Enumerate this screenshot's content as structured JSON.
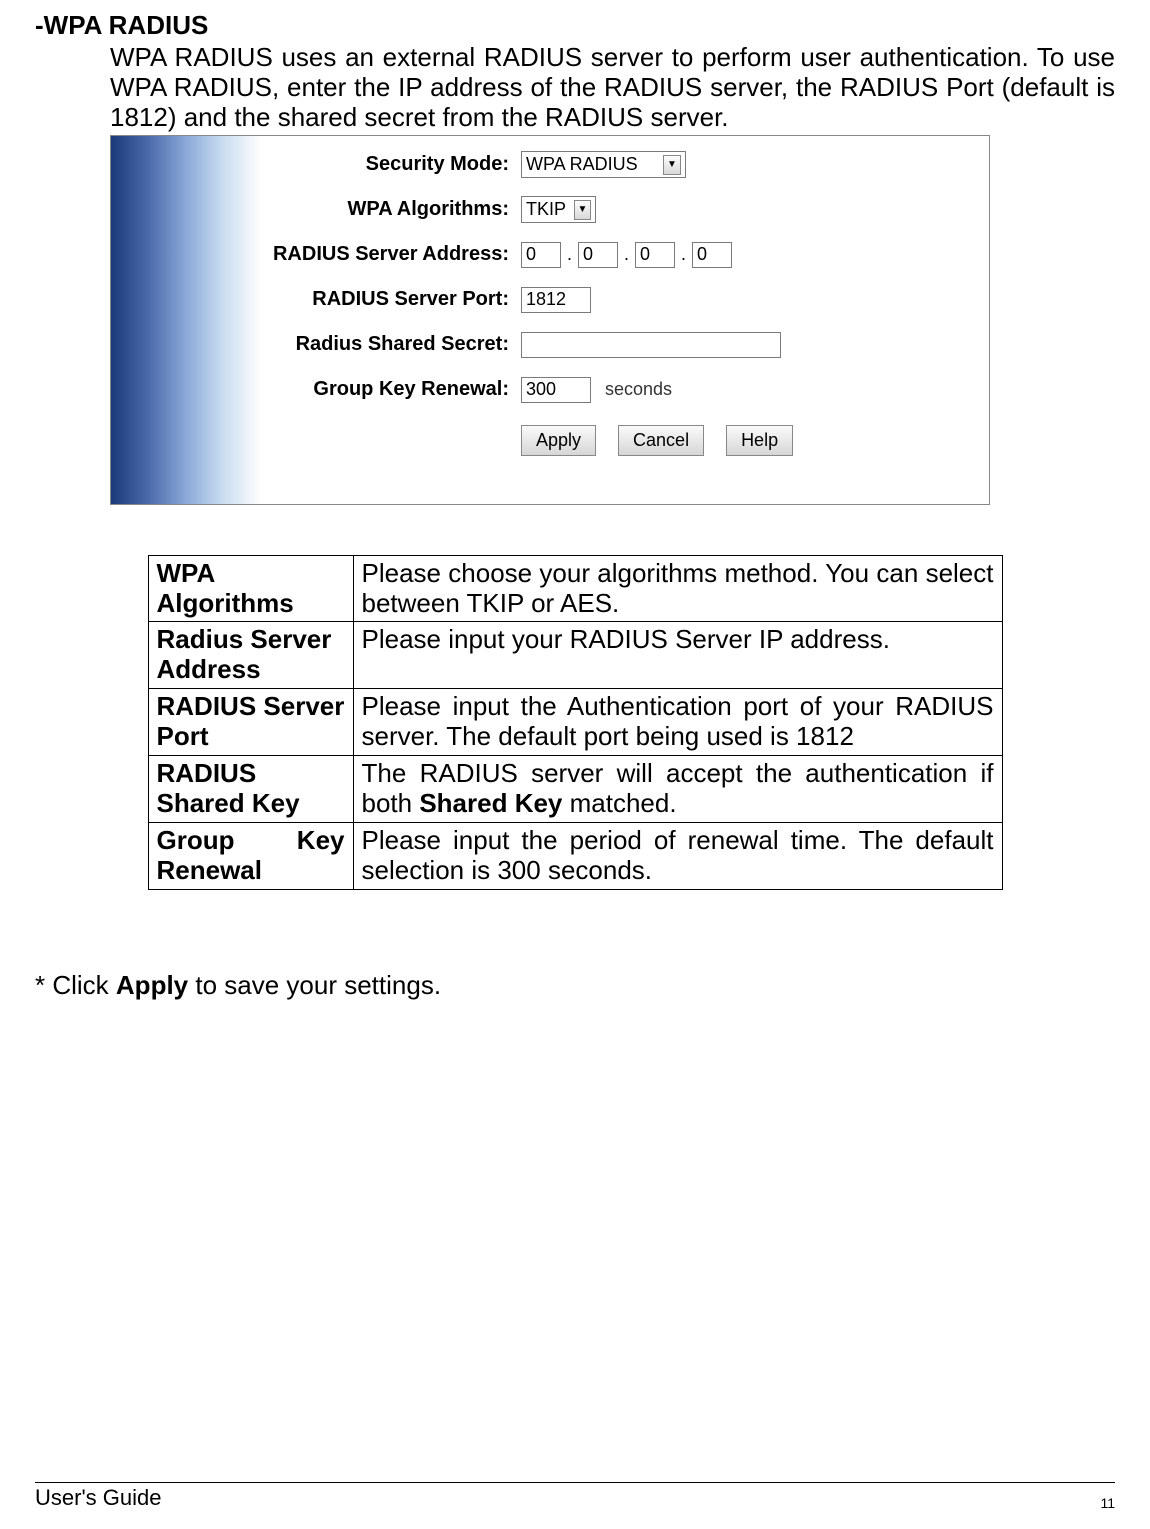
{
  "heading": "-WPA RADIUS",
  "intro": "WPA RADIUS uses an external RADIUS server to perform user authentication. To use WPA RADIUS, enter the IP address of the RADIUS server, the RADIUS Port (default is 1812) and the shared secret from the RADIUS server.",
  "form": {
    "security_mode": {
      "label": "Security Mode:",
      "value": "WPA RADIUS"
    },
    "wpa_algorithms": {
      "label": "WPA Algorithms:",
      "value": "TKIP"
    },
    "server_address": {
      "label": "RADIUS Server Address:",
      "oct1": "0",
      "oct2": "0",
      "oct3": "0",
      "oct4": "0"
    },
    "server_port": {
      "label": "RADIUS Server Port:",
      "value": "1812"
    },
    "shared_secret": {
      "label": "Radius Shared Secret:",
      "value": ""
    },
    "group_key_renewal": {
      "label": "Group Key Renewal:",
      "value": "300",
      "unit": "seconds"
    },
    "buttons": {
      "apply": "Apply",
      "cancel": "Cancel",
      "help": "Help"
    }
  },
  "table": {
    "rows": [
      {
        "label": "WPA Algorithms",
        "desc": "Please choose your algorithms method. You can select between TKIP or AES."
      },
      {
        "label": "Radius Server Address",
        "desc": "Please input your RADIUS Server IP address."
      },
      {
        "label": "RADIUS Server Port",
        "desc": "Please input the Authentication port of your RADIUS server. The default port being used is 1812"
      },
      {
        "label": "RADIUS Shared Key",
        "desc_pre": "The RADIUS server will accept the authentication if both ",
        "desc_bold": "Shared Key",
        "desc_post": " matched."
      },
      {
        "label_a": "Group",
        "label_b": "Key",
        "label_c": "Renewal",
        "desc": "Please input the period of renewal time. The default selection is 300 seconds."
      }
    ]
  },
  "apply_note_pre": "* Click ",
  "apply_note_bold": "Apply",
  "apply_note_post": " to save your settings.",
  "footer": {
    "left": "User's Guide",
    "right": "11"
  }
}
